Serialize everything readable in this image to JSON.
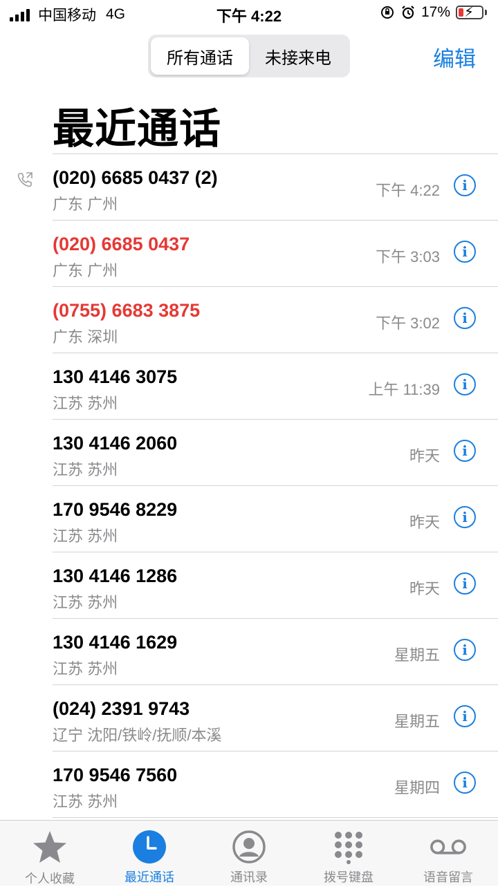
{
  "status_bar": {
    "carrier": "中国移动",
    "network": "4G",
    "time": "下午 4:22",
    "battery": "17%"
  },
  "segmented": {
    "all_label": "所有通话",
    "missed_label": "未接来电"
  },
  "header": {
    "edit_label": "编辑",
    "title": "最近通话"
  },
  "calls": [
    {
      "number": "(020) 6685 0437 (2)",
      "location": "广东 广州",
      "time": "下午 4:22",
      "missed": false,
      "outgoing": true
    },
    {
      "number": "(020) 6685 0437",
      "location": "广东 广州",
      "time": "下午 3:03",
      "missed": true,
      "outgoing": false
    },
    {
      "number": "(0755) 6683 3875",
      "location": "广东 深圳",
      "time": "下午 3:02",
      "missed": true,
      "outgoing": false
    },
    {
      "number": "130 4146 3075",
      "location": "江苏 苏州",
      "time": "上午 11:39",
      "missed": false,
      "outgoing": false
    },
    {
      "number": "130 4146 2060",
      "location": "江苏 苏州",
      "time": "昨天",
      "missed": false,
      "outgoing": false
    },
    {
      "number": "170 9546 8229",
      "location": "江苏 苏州",
      "time": "昨天",
      "missed": false,
      "outgoing": false
    },
    {
      "number": "130 4146 1286",
      "location": "江苏 苏州",
      "time": "昨天",
      "missed": false,
      "outgoing": false
    },
    {
      "number": "130 4146 1629",
      "location": "江苏 苏州",
      "time": "星期五",
      "missed": false,
      "outgoing": false
    },
    {
      "number": "(024) 2391 9743",
      "location": "辽宁 沈阳/铁岭/抚顺/本溪",
      "time": "星期五",
      "missed": false,
      "outgoing": false
    },
    {
      "number": "170 9546 7560",
      "location": "江苏 苏州",
      "time": "星期四",
      "missed": false,
      "outgoing": false
    }
  ],
  "tab_bar": [
    {
      "label": "个人收藏",
      "icon": "star-icon",
      "active": false
    },
    {
      "label": "最近通话",
      "icon": "clock-icon",
      "active": true
    },
    {
      "label": "通讯录",
      "icon": "contact-icon",
      "active": false
    },
    {
      "label": "拨号键盘",
      "icon": "keypad-icon",
      "active": false
    },
    {
      "label": "语音留言",
      "icon": "voicemail-icon",
      "active": false
    }
  ],
  "colors": {
    "accent": "#1a7fe0",
    "missed": "#e53935",
    "secondary_text": "#8a8a8e"
  }
}
